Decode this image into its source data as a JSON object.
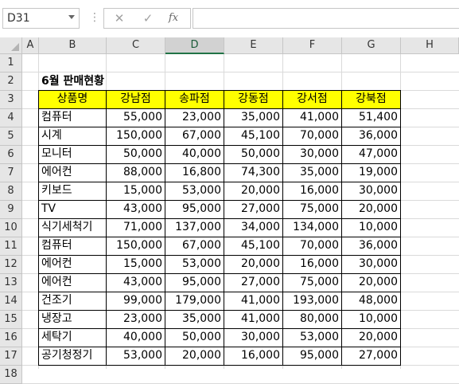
{
  "formula_bar": {
    "name_box": "D31",
    "more_dots": "⋮",
    "cancel_icon": "✕",
    "enter_icon": "✓",
    "fx_label": "fx",
    "formula": ""
  },
  "columns": [
    "A",
    "B",
    "C",
    "D",
    "E",
    "F",
    "G",
    "H"
  ],
  "selected_column": "D",
  "rows": [
    "1",
    "2",
    "3",
    "4",
    "5",
    "6",
    "7",
    "8",
    "9",
    "10",
    "11",
    "12",
    "13",
    "14",
    "15",
    "16",
    "17",
    "18"
  ],
  "sheet": {
    "title": "6월 판매현황",
    "headers": [
      "상품명",
      "강남점",
      "송파점",
      "강동점",
      "강서점",
      "강북점"
    ],
    "data": [
      [
        "컴퓨터",
        "55,000",
        "23,000",
        "35,000",
        "41,000",
        "51,400"
      ],
      [
        "시계",
        "150,000",
        "67,000",
        "45,100",
        "70,000",
        "36,000"
      ],
      [
        "모니터",
        "50,000",
        "40,000",
        "50,000",
        "30,000",
        "47,000"
      ],
      [
        "에어컨",
        "88,000",
        "16,800",
        "74,300",
        "35,000",
        "19,000"
      ],
      [
        "키보드",
        "15,000",
        "53,000",
        "20,000",
        "16,000",
        "30,000"
      ],
      [
        "TV",
        "43,000",
        "95,000",
        "27,000",
        "75,000",
        "20,000"
      ],
      [
        "식기세척기",
        "71,000",
        "137,000",
        "34,000",
        "134,000",
        "10,000"
      ],
      [
        "컴퓨터",
        "150,000",
        "67,000",
        "45,100",
        "70,000",
        "36,000"
      ],
      [
        "에어컨",
        "15,000",
        "53,000",
        "20,000",
        "16,000",
        "30,000"
      ],
      [
        "에어컨",
        "43,000",
        "95,000",
        "27,000",
        "75,000",
        "20,000"
      ],
      [
        "건조기",
        "99,000",
        "179,000",
        "41,000",
        "193,000",
        "48,000"
      ],
      [
        "냉장고",
        "23,000",
        "35,000",
        "41,000",
        "80,000",
        "10,000"
      ],
      [
        "세탁기",
        "40,000",
        "50,000",
        "30,000",
        "53,000",
        "20,000"
      ],
      [
        "공기청정기",
        "53,000",
        "20,000",
        "16,000",
        "95,000",
        "27,000"
      ]
    ]
  },
  "colors": {
    "header_fill": "#ffff00",
    "selected_col_accent": "#217346"
  }
}
